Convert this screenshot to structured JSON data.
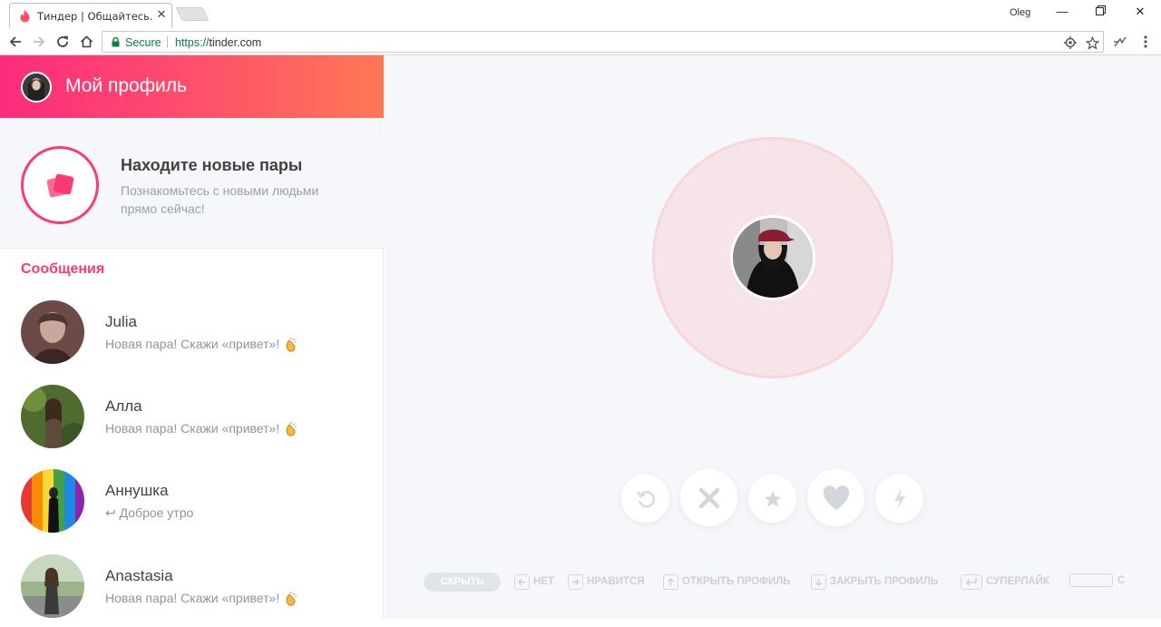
{
  "browser": {
    "tab_title": "Тиндер | Общайтесь. Вс",
    "user": "Oleg",
    "secure_label": "Secure",
    "url_scheme": "https://",
    "url_host": "tinder.com"
  },
  "sidebar": {
    "profile_title": "Мой профиль",
    "discover_title": "Находите новые пары",
    "discover_subtitle": "Познакомьтесь с новыми людьми прямо сейчас!",
    "messages_heading": "Сообщения",
    "messages": [
      {
        "name": "Julia",
        "preview": "Новая пара! Скажи «привет»!",
        "emoji": "clapping-hands-icon"
      },
      {
        "name": "Алла",
        "preview": "Новая пара! Скажи «привет»!",
        "emoji": "clapping-hands-icon"
      },
      {
        "name": "Аннушка",
        "preview": "↩ Доброе утро",
        "emoji": ""
      },
      {
        "name": "Anastasia",
        "preview": "Новая пара! Скажи «привет»!",
        "emoji": "clapping-hands-icon"
      }
    ]
  },
  "main": {
    "actions": [
      "rewind-icon",
      "nope-icon",
      "superlike-icon",
      "like-icon",
      "boost-icon"
    ],
    "shortcuts": {
      "hide": "СКРЫТЬ",
      "nope": "НЕТ",
      "like": "НРАВИТСЯ",
      "open_profile": "ОТКРЫТЬ ПРОФИЛЬ",
      "close_profile": "ЗАКРЫТЬ ПРОФИЛЬ",
      "superlike": "СУПЕРЛАЙК",
      "space_partial": "С"
    }
  },
  "colors": {
    "brand_gradient_start": "#fd2b7c",
    "brand_gradient_end": "#ff7854",
    "accent": "#fd3a73",
    "secure_green": "#0b8043"
  }
}
